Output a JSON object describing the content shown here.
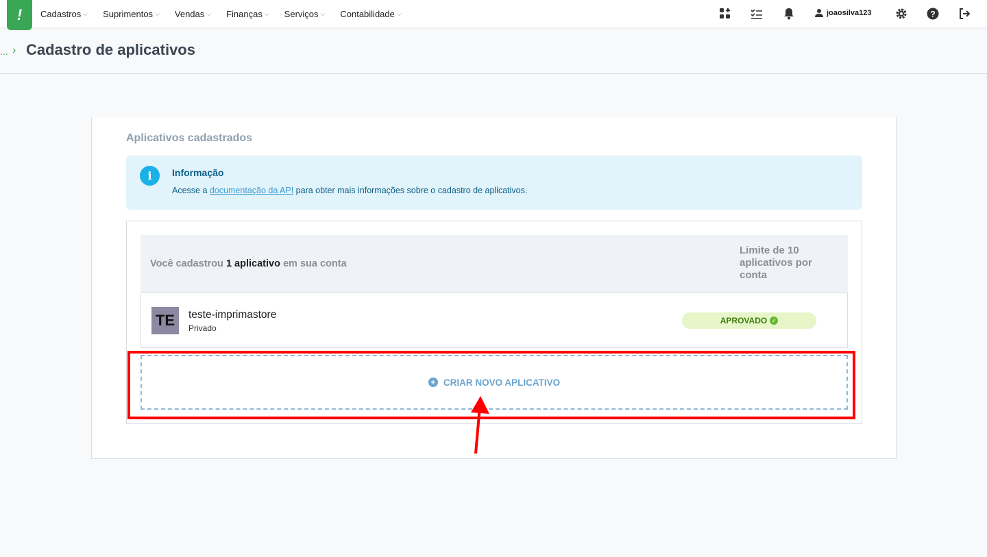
{
  "nav": {
    "logo": "!",
    "menu": [
      "Cadastros",
      "Suprimentos",
      "Vendas",
      "Finanças",
      "Serviços",
      "Contabilidade"
    ],
    "user": "joaosilva123",
    "icons": [
      "apps-icon",
      "checklist-icon",
      "bell-icon",
      "user-icon",
      "gear-icon",
      "help-icon",
      "logout-icon"
    ]
  },
  "breadcrumb": {
    "dots": "...",
    "separator": "›",
    "title": "Cadastro de aplicativos"
  },
  "card": {
    "title": "Aplicativos cadastrados",
    "info": {
      "icon": "i",
      "title": "Informação",
      "text_before": "Acesse a ",
      "link": "documentação da API",
      "text_after": " para obter mais informações sobre o cadastro de aplicativos."
    },
    "summary": {
      "prefix": "Você cadastrou ",
      "count": "1 aplicativo",
      "suffix": " em sua conta",
      "limit": "Limite de 10 aplicativos por conta"
    },
    "apps": [
      {
        "initials": "TE",
        "name": "teste-imprimastore",
        "type": "Privado",
        "status": "APROVADO"
      }
    ],
    "create_label": "CRIAR NOVO APLICATIVO"
  },
  "colors": {
    "brand": "#3aa757",
    "highlight": "#ff0000",
    "info_bg": "#e1f3fb",
    "approved_bg": "#e6f6c9"
  }
}
